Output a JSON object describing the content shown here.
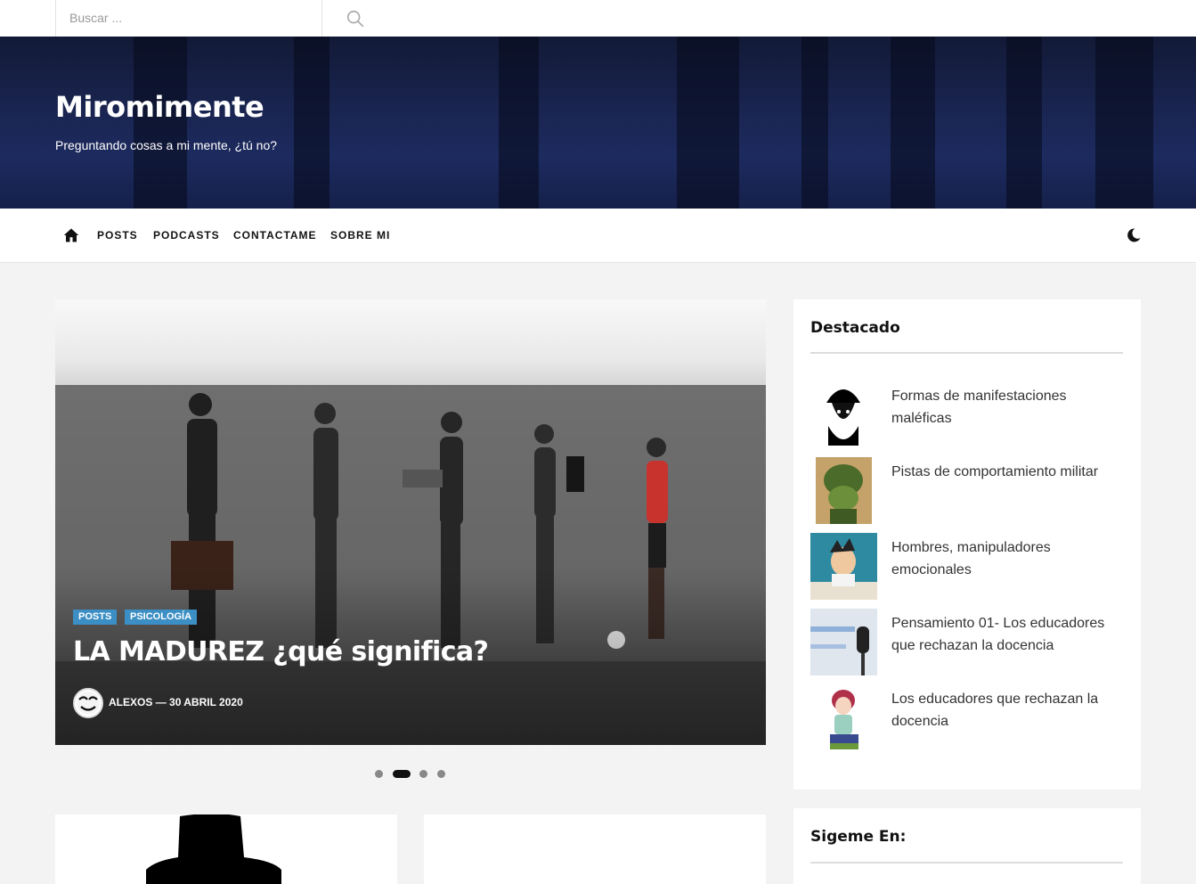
{
  "search": {
    "placeholder": "Buscar ...",
    "value": ""
  },
  "site": {
    "title": "Miromimente",
    "tagline": "Preguntando cosas a mi mente, ¿tú no?"
  },
  "nav": {
    "items": [
      {
        "label": "POSTS"
      },
      {
        "label": "PODCASTS"
      },
      {
        "label": "CONTACTAME"
      },
      {
        "label": "SOBRE MI"
      }
    ]
  },
  "slider": {
    "categories": [
      {
        "label": "POSTS"
      },
      {
        "label": "PSICOLOGÍA"
      }
    ],
    "title": "LA MADUREZ ¿qué significa?",
    "author": "ALEXOS",
    "separator": "—",
    "date": "30 ABRIL 2020",
    "active_dot": 2,
    "dot_count": 4
  },
  "sidebar": {
    "featured": {
      "title": "Destacado",
      "items": [
        {
          "title": "Formas de manifestaciones maléficas"
        },
        {
          "title": "Pistas de comportamiento militar"
        },
        {
          "title": "Hombres, manipuladores emocionales"
        },
        {
          "title": "Pensamiento 01- Los educadores que rechazan la docencia"
        },
        {
          "title": "Los educadores que rechazan la docencia"
        }
      ]
    },
    "follow": {
      "title": "Sigeme En:"
    }
  },
  "colors": {
    "accent": "#3b8fc4",
    "hero": "#1a2552",
    "page_bg": "#f3f3f3"
  }
}
